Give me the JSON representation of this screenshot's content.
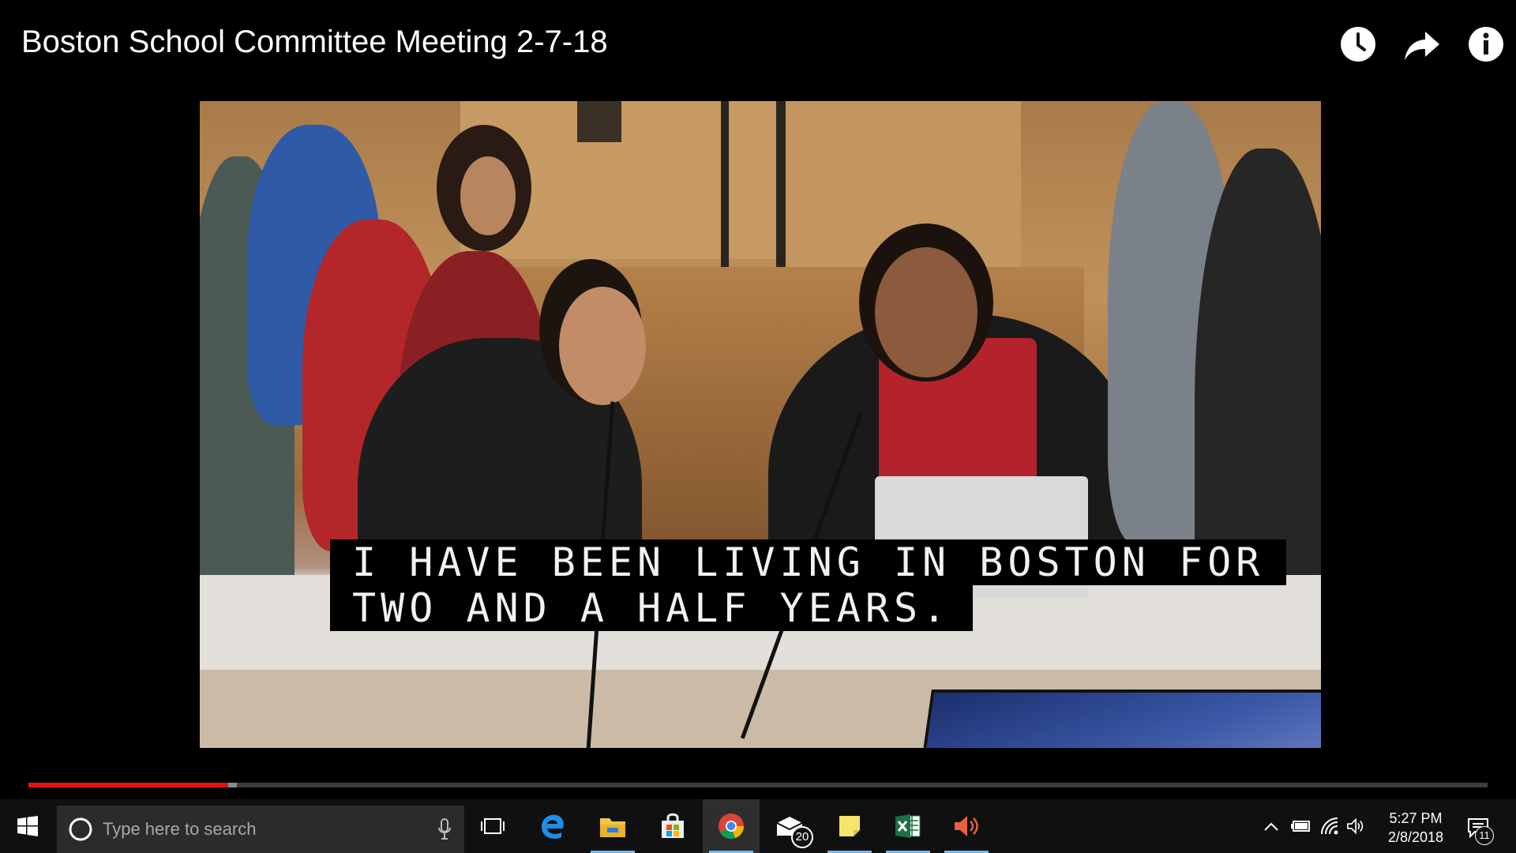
{
  "video": {
    "title": "Boston School Committee Meeting 2-7-18",
    "captions": [
      "I HAVE BEEN LIVING IN BOSTON FOR",
      "TWO AND A HALF YEARS."
    ],
    "progress_fraction": 0.137,
    "buffered_fraction": 0.143,
    "top_icons": [
      "clock-icon",
      "share-icon",
      "info-icon"
    ],
    "colors": {
      "progress": "#e01414",
      "buffer": "#8c8c8c",
      "track": "#3d3d3d"
    }
  },
  "taskbar": {
    "search_placeholder": "Type here to search",
    "apps": [
      {
        "name": "task-view-icon"
      },
      {
        "name": "edge-icon"
      },
      {
        "name": "file-explorer-icon"
      },
      {
        "name": "store-icon"
      },
      {
        "name": "chrome-icon",
        "active": true
      },
      {
        "name": "mail-icon",
        "badge": "20"
      },
      {
        "name": "sticky-notes-icon"
      },
      {
        "name": "excel-icon"
      },
      {
        "name": "speaker-app-icon"
      }
    ],
    "time": "5:27 PM",
    "date": "2/8/2018",
    "notification_count": "11"
  }
}
